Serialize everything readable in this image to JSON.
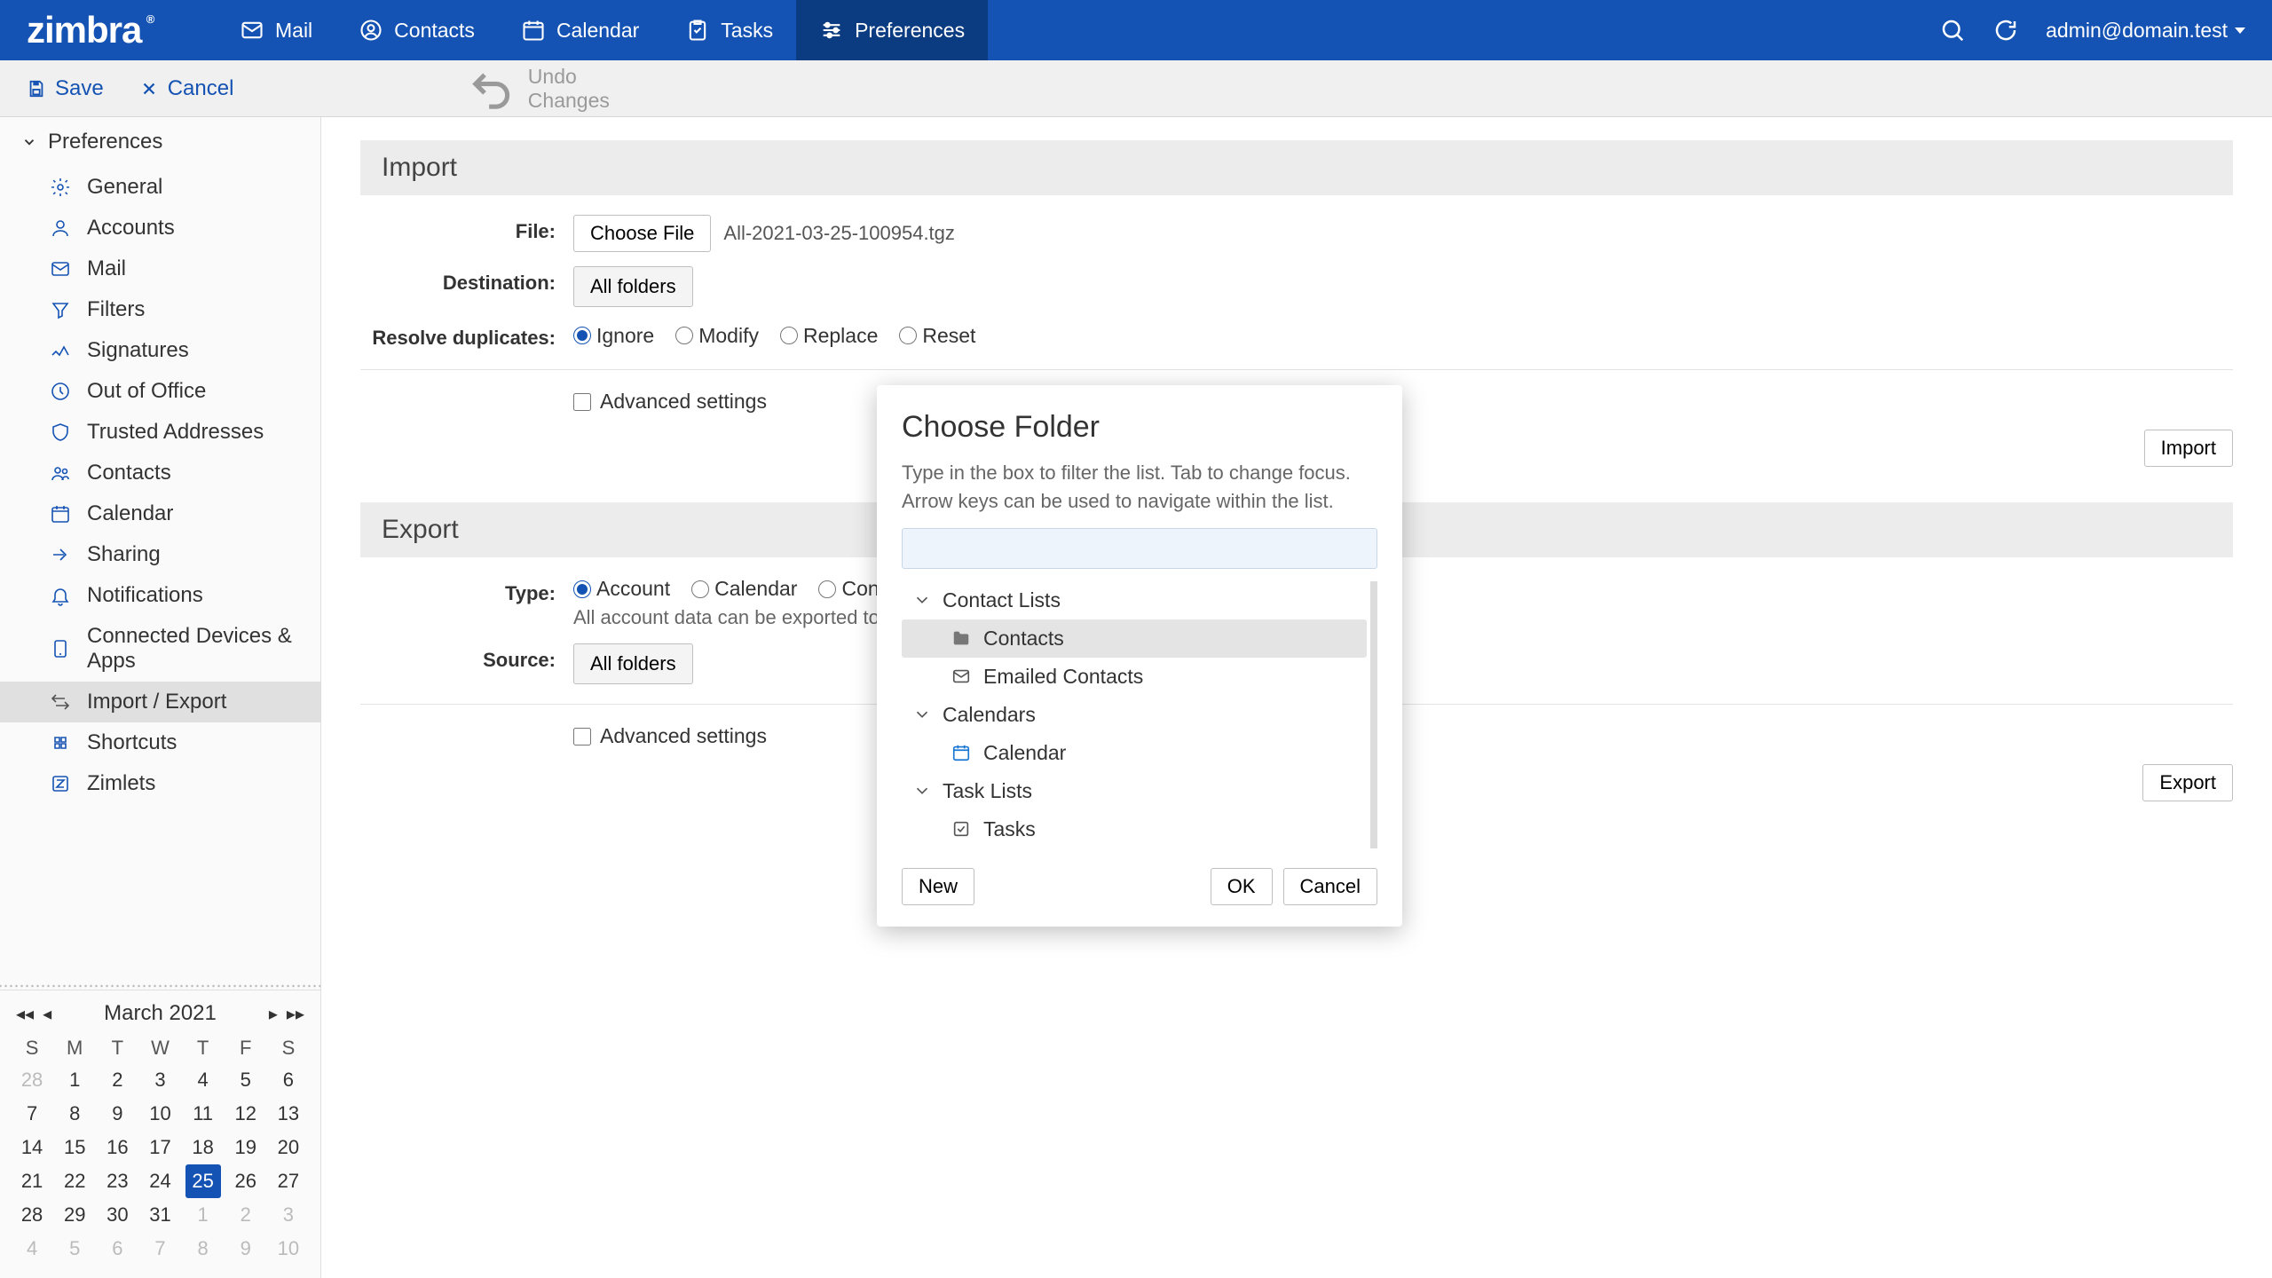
{
  "header": {
    "logo": "zimbra",
    "tabs": [
      {
        "label": "Mail"
      },
      {
        "label": "Contacts"
      },
      {
        "label": "Calendar"
      },
      {
        "label": "Tasks"
      },
      {
        "label": "Preferences"
      }
    ],
    "user": "admin@domain.test"
  },
  "toolbar": {
    "save": "Save",
    "cancel": "Cancel",
    "undo": "Undo Changes"
  },
  "sidebar": {
    "title": "Preferences",
    "items": [
      {
        "label": "General"
      },
      {
        "label": "Accounts"
      },
      {
        "label": "Mail"
      },
      {
        "label": "Filters"
      },
      {
        "label": "Signatures"
      },
      {
        "label": "Out of Office"
      },
      {
        "label": "Trusted Addresses"
      },
      {
        "label": "Contacts"
      },
      {
        "label": "Calendar"
      },
      {
        "label": "Sharing"
      },
      {
        "label": "Notifications"
      },
      {
        "label": "Connected Devices & Apps"
      },
      {
        "label": "Import / Export"
      },
      {
        "label": "Shortcuts"
      },
      {
        "label": "Zimlets"
      }
    ]
  },
  "calendar": {
    "title": "March 2021",
    "dow": [
      "S",
      "M",
      "T",
      "W",
      "T",
      "F",
      "S"
    ],
    "days": [
      {
        "n": "28",
        "muted": true
      },
      {
        "n": "1"
      },
      {
        "n": "2"
      },
      {
        "n": "3"
      },
      {
        "n": "4"
      },
      {
        "n": "5"
      },
      {
        "n": "6"
      },
      {
        "n": "7"
      },
      {
        "n": "8"
      },
      {
        "n": "9"
      },
      {
        "n": "10"
      },
      {
        "n": "11"
      },
      {
        "n": "12"
      },
      {
        "n": "13"
      },
      {
        "n": "14"
      },
      {
        "n": "15"
      },
      {
        "n": "16"
      },
      {
        "n": "17"
      },
      {
        "n": "18"
      },
      {
        "n": "19"
      },
      {
        "n": "20"
      },
      {
        "n": "21"
      },
      {
        "n": "22"
      },
      {
        "n": "23"
      },
      {
        "n": "24"
      },
      {
        "n": "25",
        "today": true
      },
      {
        "n": "26"
      },
      {
        "n": "27"
      },
      {
        "n": "28"
      },
      {
        "n": "29"
      },
      {
        "n": "30"
      },
      {
        "n": "31"
      },
      {
        "n": "1",
        "muted": true
      },
      {
        "n": "2",
        "muted": true
      },
      {
        "n": "3",
        "muted": true
      },
      {
        "n": "4",
        "muted": true
      },
      {
        "n": "5",
        "muted": true
      },
      {
        "n": "6",
        "muted": true
      },
      {
        "n": "7",
        "muted": true
      },
      {
        "n": "8",
        "muted": true
      },
      {
        "n": "9",
        "muted": true
      },
      {
        "n": "10",
        "muted": true
      }
    ]
  },
  "import": {
    "title": "Import",
    "file_label": "File:",
    "choose_file": "Choose File",
    "file_name": "All-2021-03-25-100954.tgz",
    "dest_label": "Destination:",
    "all_folders": "All folders",
    "resolve_label": "Resolve duplicates:",
    "opts": {
      "ignore": "Ignore",
      "modify": "Modify",
      "replace": "Replace",
      "reset": "Reset"
    },
    "advanced": "Advanced settings",
    "import_btn": "Import"
  },
  "export": {
    "title": "Export",
    "type_label": "Type:",
    "opts": {
      "account": "Account",
      "calendar": "Calendar",
      "contacts": "Contacts"
    },
    "desc": "All account data can be exported to a \"Tar",
    "source_label": "Source:",
    "all_folders": "All folders",
    "advanced": "Advanced settings",
    "export_btn": "Export"
  },
  "dialog": {
    "title": "Choose Folder",
    "desc": "Type in the box to filter the list. Tab to change focus. Arrow keys can be used to navigate within the list.",
    "groups": {
      "contacts": "Contact Lists",
      "calendars": "Calendars",
      "tasks": "Task Lists"
    },
    "items": {
      "contacts": "Contacts",
      "emailed": "Emailed Contacts",
      "calendar": "Calendar",
      "tasks": "Tasks"
    },
    "new": "New",
    "ok": "OK",
    "cancel": "Cancel"
  }
}
